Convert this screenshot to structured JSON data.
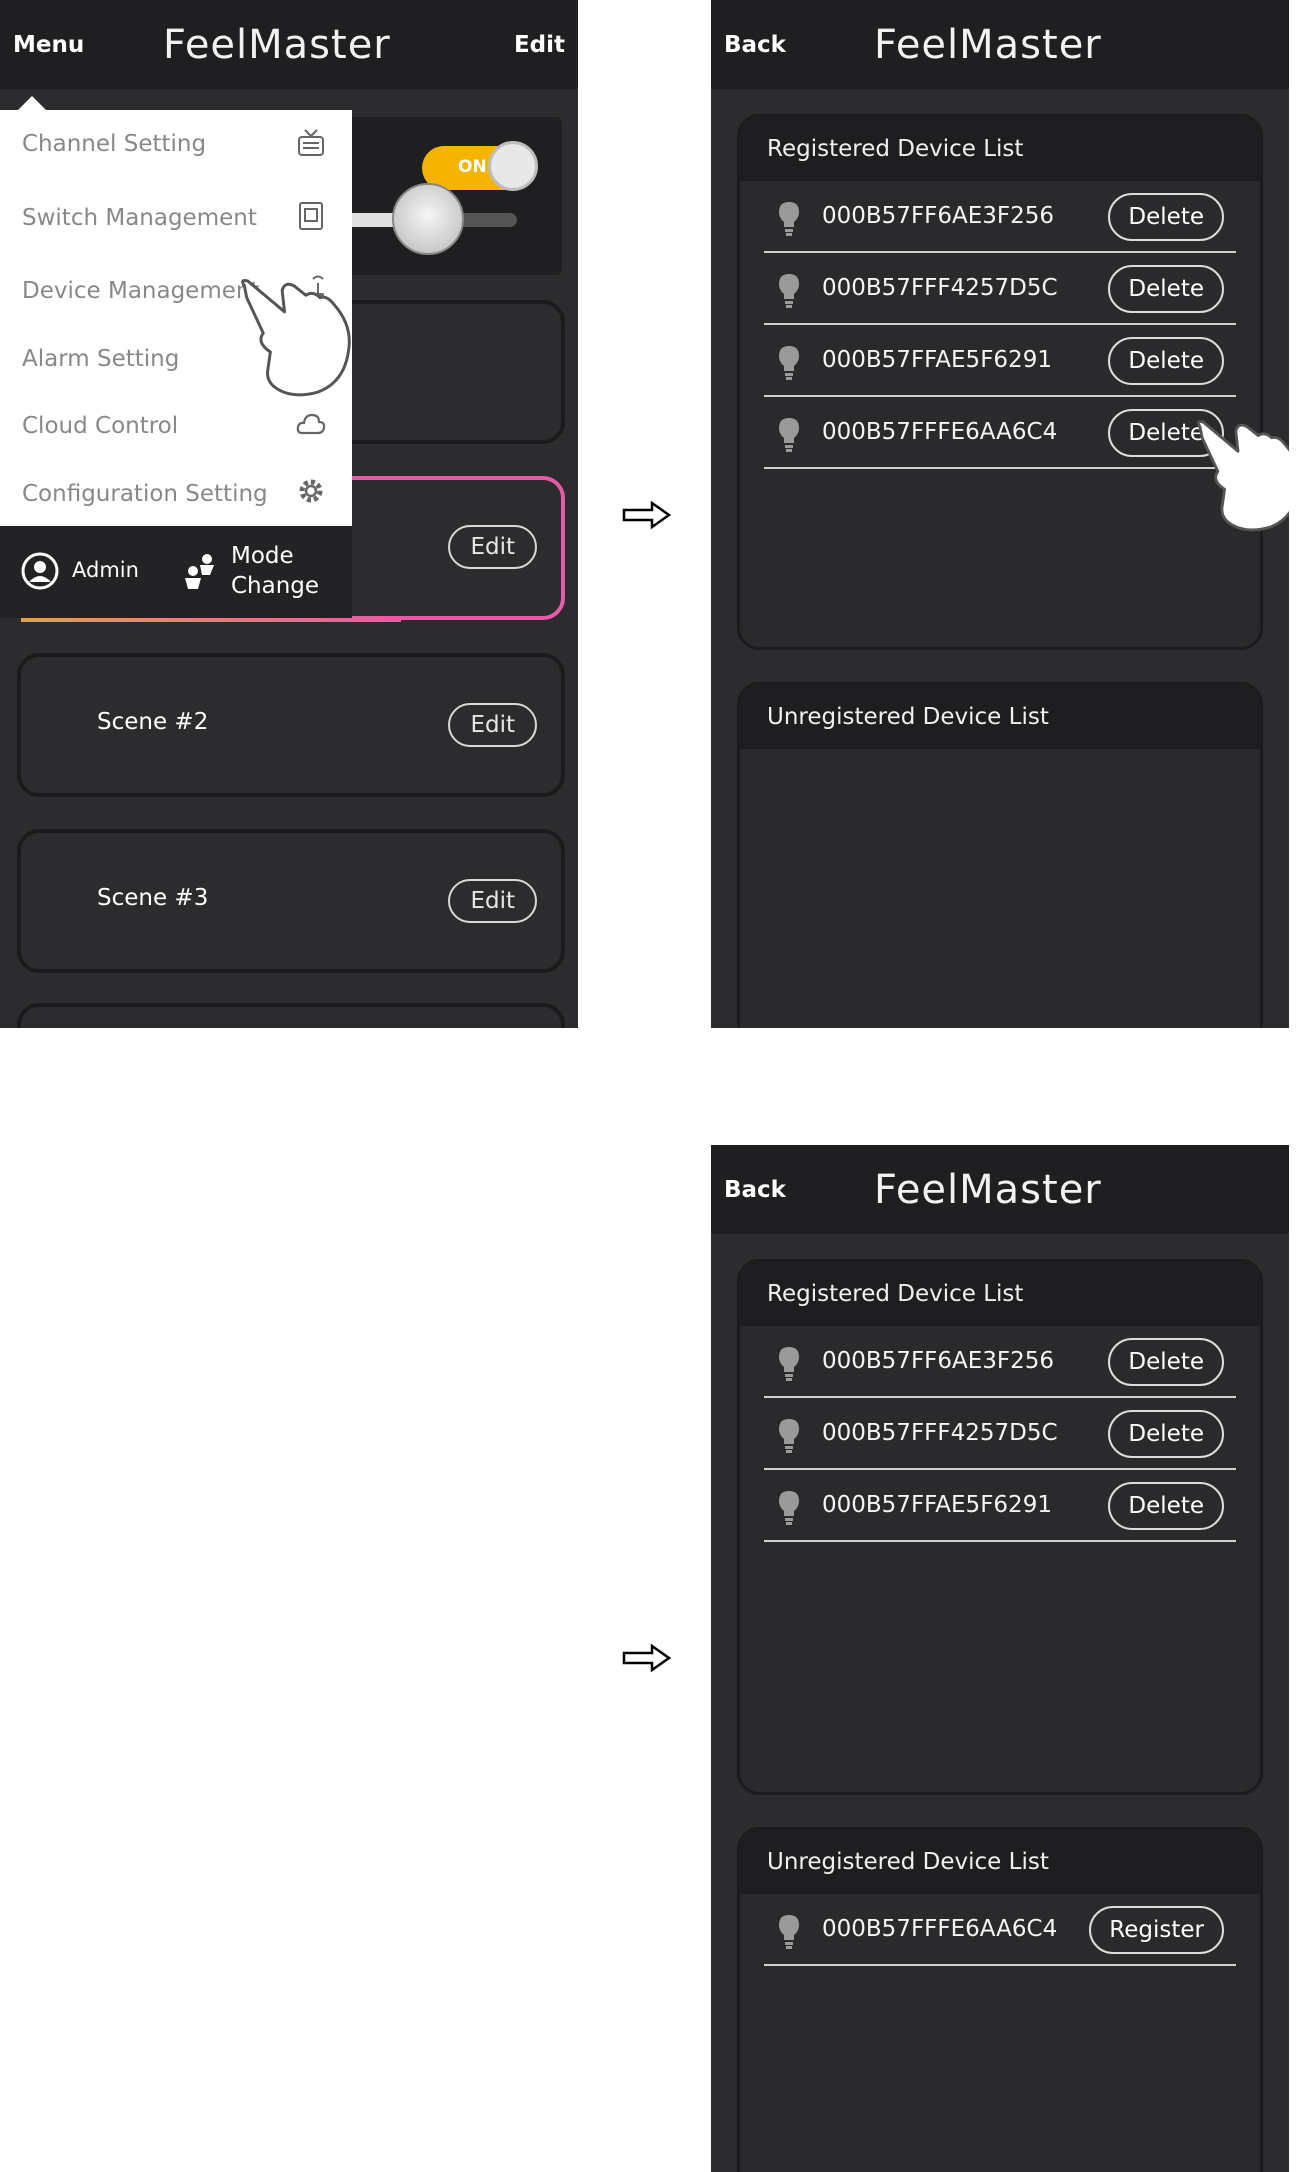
{
  "screen1": {
    "appbar": {
      "left": "Menu",
      "brand": "FeelMaster",
      "right": "Edit"
    },
    "toggle": {
      "label": "ON"
    },
    "menu": {
      "items": [
        {
          "label": "Channel Setting",
          "icon": "tv-icon"
        },
        {
          "label": "Switch Management",
          "icon": "switch-icon"
        },
        {
          "label": "Device Management",
          "icon": "router-icon"
        },
        {
          "label": "Alarm Setting",
          "icon": ""
        },
        {
          "label": "Cloud Control",
          "icon": "cloud-icon"
        },
        {
          "label": "Configuration Setting",
          "icon": "gear-icon"
        }
      ],
      "footer": {
        "admin": "Admin",
        "mode_line1": "Mode",
        "mode_line2": "Change"
      }
    },
    "scenes": [
      {
        "label": "",
        "edit": "Edit"
      },
      {
        "label": "Scene #2",
        "edit": "Edit"
      },
      {
        "label": "Scene #3",
        "edit": "Edit"
      }
    ]
  },
  "screen2": {
    "appbar": {
      "left": "Back",
      "brand": "FeelMaster"
    },
    "registered": {
      "title": "Registered Device List",
      "devices": [
        {
          "id": "000B57FF6AE3F256",
          "action": "Delete"
        },
        {
          "id": "000B57FFF4257D5C",
          "action": "Delete"
        },
        {
          "id": "000B57FFAE5F6291",
          "action": "Delete"
        },
        {
          "id": "000B57FFFE6AA6C4",
          "action": "Delete"
        }
      ]
    },
    "unregistered": {
      "title": "Unregistered Device List",
      "devices": []
    }
  },
  "screen3": {
    "appbar": {
      "left": "Back",
      "brand": "FeelMaster"
    },
    "registered": {
      "title": "Registered Device List",
      "devices": [
        {
          "id": "000B57FF6AE3F256",
          "action": "Delete"
        },
        {
          "id": "000B57FFF4257D5C",
          "action": "Delete"
        },
        {
          "id": "000B57FFAE5F6291",
          "action": "Delete"
        }
      ]
    },
    "unregistered": {
      "title": "Unregistered Device List",
      "devices": [
        {
          "id": "000B57FFFE6AA6C4",
          "action": "Register"
        }
      ]
    }
  }
}
